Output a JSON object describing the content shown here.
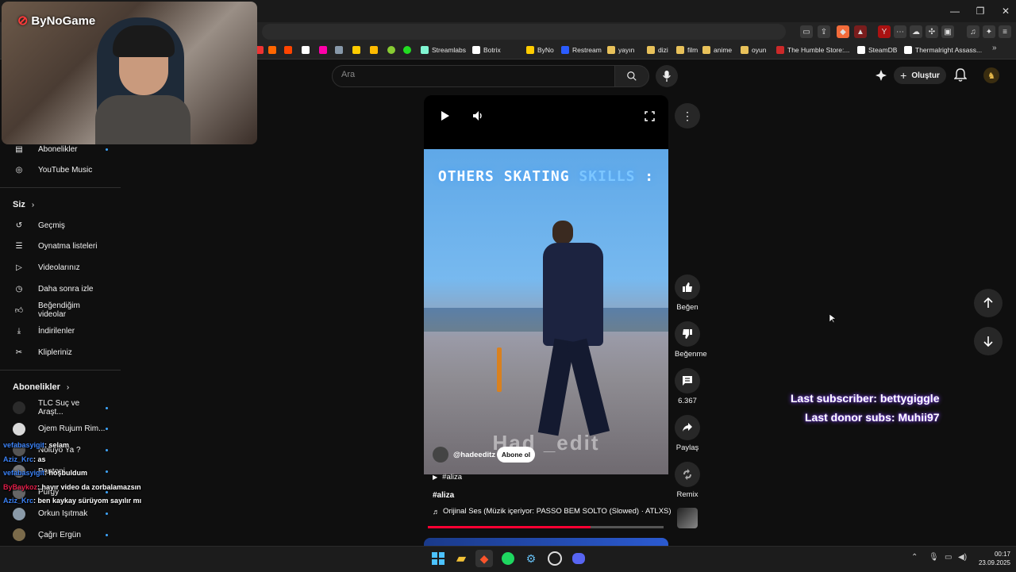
{
  "webcam": {
    "logo": "ByNoGame"
  },
  "bookmarks": [
    {
      "label": "Streamlabs",
      "color": "#80f5d2"
    },
    {
      "label": "Botrix",
      "color": "#ffffff"
    },
    {
      "label": "ByNo",
      "color": "#ffcc00"
    },
    {
      "label": "Restream",
      "color": "#2b5cff"
    },
    {
      "label": "yayın",
      "color": "#e8c15a"
    },
    {
      "label": "dizi",
      "color": "#e8c15a"
    },
    {
      "label": "film",
      "color": "#e8c15a"
    },
    {
      "label": "anime",
      "color": "#e8c15a"
    },
    {
      "label": "oyun",
      "color": "#e8c15a"
    },
    {
      "label": "The Humble Store:...",
      "color": "#cc2929"
    },
    {
      "label": "SteamDB",
      "color": "#ffffff"
    },
    {
      "label": "Thermalright Assass...",
      "color": "#ffffff"
    }
  ],
  "search": {
    "placeholder": "Ara"
  },
  "header": {
    "create_label": "Oluştur"
  },
  "sidebar": {
    "top_items": [
      {
        "label": "Abonelikler",
        "icon": "subscriptions-icon"
      },
      {
        "label": "YouTube Music",
        "icon": "music-icon"
      }
    ],
    "you_heading": "Siz",
    "you_items": [
      {
        "label": "Geçmiş",
        "icon": "history-icon"
      },
      {
        "label": "Oynatma listeleri",
        "icon": "playlist-icon"
      },
      {
        "label": "Videolarınız",
        "icon": "your-videos-icon"
      },
      {
        "label": "Daha sonra izle",
        "icon": "watch-later-icon"
      },
      {
        "label": "Beğendiğim videolar",
        "icon": "liked-icon"
      },
      {
        "label": "İndirilenler",
        "icon": "download-icon"
      },
      {
        "label": "Klipleriniz",
        "icon": "clips-icon"
      }
    ],
    "subs_heading": "Abonelikler",
    "subs": [
      {
        "label": "TLC Suç ve Araşt...",
        "color": "#2b2b2b"
      },
      {
        "label": "Ojem Rujum Rim...",
        "color": "#d9d9d9"
      },
      {
        "label": "Noluyo Ya ?",
        "color": "#555"
      },
      {
        "label": "Pantoni",
        "color": "#777"
      },
      {
        "label": "Purgy",
        "color": "#666"
      },
      {
        "label": "Orkun Işıtmak",
        "color": "#8a9aa8"
      },
      {
        "label": "Çağrı Ergün",
        "color": "#7a6a4a"
      }
    ]
  },
  "video": {
    "overlay_title_1": "OTHERS SKATING ",
    "overlay_title_2": "SKILLS",
    "overlay_title_3": " :",
    "watermark": "Had _edit",
    "channel": "@hadeeditz",
    "subscribe_label": "Abone ol",
    "hashtag_link": "#aliza",
    "title": "#aliza",
    "audio": "Orijinal Ses (Müzik içeriyor: PASSO BEM SOLTO (Slowed) · ATLXS)",
    "progress": 0.69
  },
  "actions": {
    "like": "Beğen",
    "dislike": "Beğenme",
    "comments": "6.367",
    "share": "Paylaş",
    "remix": "Remix"
  },
  "stream_overlay": {
    "last_subscriber": "Last subscriber: bettygiggle",
    "last_donor": "Last donor subs: Muhii97"
  },
  "chat": [
    {
      "user": "vefabasyigit",
      "msg": ": selam",
      "color": "#3b82f6"
    },
    {
      "user": "Aziz_Krc",
      "msg": ": as",
      "color": "#3b82f6"
    },
    {
      "user": "vefabasyigit",
      "msg": ": hoşbuldum",
      "color": "#3b82f6"
    },
    {
      "user": "ByBaykoz",
      "msg": ": hayır video da zorbalamazsın",
      "color": "#e11d48"
    },
    {
      "user": "Aziz_Krc",
      "msg": ": ben kaykay sürüyom sayılır mı",
      "color": "#3b82f6"
    }
  ],
  "taskbar": {
    "time": "00:17",
    "date": "23.09.2025"
  }
}
